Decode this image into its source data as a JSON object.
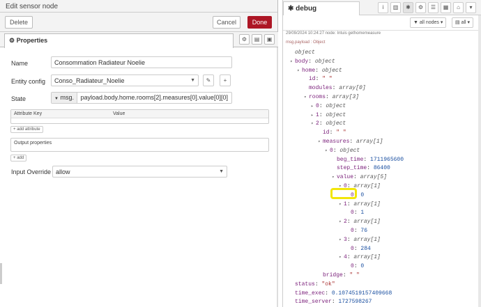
{
  "tray": {
    "title": "Edit sensor node",
    "delete_label": "Delete",
    "cancel_label": "Cancel",
    "done_label": "Done",
    "tab_label": "Properties",
    "name_label": "Name",
    "name_value": "Consommation Radiateur Noelie",
    "entity_label": "Entity config",
    "entity_value": "Conso_Radiateur_Noelie",
    "state_label": "State",
    "state_type": "msg.",
    "state_value": "payload.body.home.rooms[2].measures[0].value[0][0]",
    "attr_key_header": "Attribute Key",
    "attr_value_header": "Value",
    "add_attribute_label": "add attribute",
    "output_props_header": "Output properties",
    "add_label": "add",
    "override_label": "Input Override",
    "override_value": "allow"
  },
  "debug": {
    "tab_label": "debug",
    "filter_nodes": "all nodes",
    "filter_all": "all",
    "meta": "29/09/2024 10:24:27   node: Intuis gethomemeasure",
    "topic": "msg.payload : Object",
    "lines": [
      {
        "indent": 0,
        "caret": "",
        "key": "",
        "val": "object",
        "vclass": "t"
      },
      {
        "indent": 0,
        "caret": "▾",
        "key": "body",
        "val": "object",
        "vclass": "t"
      },
      {
        "indent": 1,
        "caret": "▾",
        "key": "home",
        "val": "object",
        "vclass": "t"
      },
      {
        "indent": 2,
        "caret": "",
        "key": "id",
        "val": "\"                    \"",
        "vclass": "s"
      },
      {
        "indent": 2,
        "caret": "",
        "key": "modules",
        "val": "array[0]",
        "vclass": "t"
      },
      {
        "indent": 2,
        "caret": "▾",
        "key": "rooms",
        "val": "array[3]",
        "vclass": "t"
      },
      {
        "indent": 3,
        "caret": "▸",
        "key": "0",
        "val": "object",
        "vclass": "t"
      },
      {
        "indent": 3,
        "caret": "▸",
        "key": "1",
        "val": "object",
        "vclass": "t"
      },
      {
        "indent": 3,
        "caret": "▾",
        "key": "2",
        "val": "object",
        "vclass": "t"
      },
      {
        "indent": 4,
        "caret": "",
        "key": "id",
        "val": "\"           \"",
        "vclass": "s"
      },
      {
        "indent": 4,
        "caret": "▾",
        "key": "measures",
        "val": "array[1]",
        "vclass": "t"
      },
      {
        "indent": 5,
        "caret": "▾",
        "key": "0",
        "val": "object",
        "vclass": "t"
      },
      {
        "indent": 6,
        "caret": "",
        "key": "beg_time",
        "val": "1711965600",
        "vclass": "n"
      },
      {
        "indent": 6,
        "caret": "",
        "key": "step_time",
        "val": "86400",
        "vclass": "n"
      },
      {
        "indent": 6,
        "caret": "▾",
        "key": "value",
        "val": "array[5]",
        "vclass": "t"
      },
      {
        "indent": 7,
        "caret": "▾",
        "key": "0",
        "val": "array[1]",
        "vclass": "t"
      },
      {
        "indent": 8,
        "caret": "",
        "key": "0",
        "val": "0",
        "vclass": "n"
      },
      {
        "indent": 7,
        "caret": "▾",
        "key": "1",
        "val": "array[1]",
        "vclass": "t"
      },
      {
        "indent": 8,
        "caret": "",
        "key": "0",
        "val": "1",
        "vclass": "n"
      },
      {
        "indent": 7,
        "caret": "▾",
        "key": "2",
        "val": "array[1]",
        "vclass": "t"
      },
      {
        "indent": 8,
        "caret": "",
        "key": "0",
        "val": "76",
        "vclass": "n"
      },
      {
        "indent": 7,
        "caret": "▾",
        "key": "3",
        "val": "array[1]",
        "vclass": "t"
      },
      {
        "indent": 8,
        "caret": "",
        "key": "0",
        "val": "284",
        "vclass": "n"
      },
      {
        "indent": 7,
        "caret": "▾",
        "key": "4",
        "val": "array[1]",
        "vclass": "t"
      },
      {
        "indent": 8,
        "caret": "",
        "key": "0",
        "val": "0",
        "vclass": "n"
      },
      {
        "indent": 4,
        "caret": "",
        "key": "bridge",
        "val": "\"                    \"",
        "vclass": "s"
      },
      {
        "indent": 0,
        "caret": "",
        "key": "status",
        "val": "\"ok\"",
        "vclass": "s"
      },
      {
        "indent": 0,
        "caret": "",
        "key": "time_exec",
        "val": "0.1074519157409668",
        "vclass": "n"
      },
      {
        "indent": 0,
        "caret": "",
        "key": "time_server",
        "val": "1727598267",
        "vclass": "n"
      }
    ]
  }
}
